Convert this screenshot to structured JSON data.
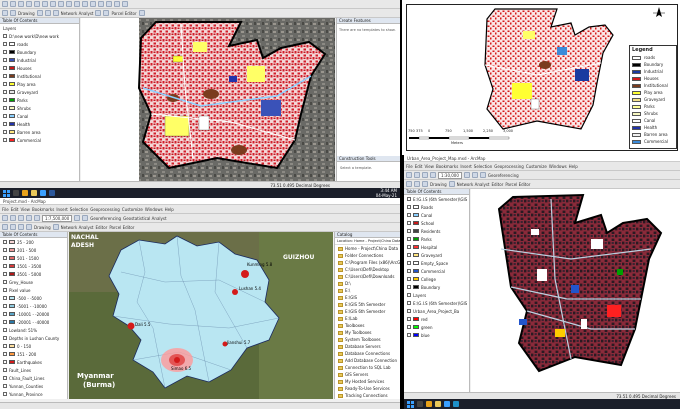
{
  "tl": {
    "toolbar": [
      "Drawing",
      "Network Analyst",
      "Parcel Editor"
    ],
    "toc_title": "Table Of Contents",
    "layers": [
      {
        "label": "Layers",
        "swatch": ""
      },
      {
        "label": "D:\\new work\\D\\new work",
        "swatch": ""
      },
      {
        "label": "roads",
        "swatch": "#ffffff"
      },
      {
        "label": "Boundary",
        "swatch": "#000000"
      },
      {
        "label": "Industrial",
        "swatch": "#3a52b8"
      },
      {
        "label": "Houses",
        "swatch": "#c81818"
      },
      {
        "label": "Institutional",
        "swatch": "#7a3c1e"
      },
      {
        "label": "Play area",
        "swatch": "#ffff33"
      },
      {
        "label": "Graveyard",
        "swatch": "#e6e6e6"
      },
      {
        "label": "Parks",
        "swatch": "#00a000"
      },
      {
        "label": "Shrubs",
        "swatch": "#f6f6c0"
      },
      {
        "label": "Canal",
        "swatch": "#8ad0ff"
      },
      {
        "label": "Health",
        "swatch": "#2233aa"
      },
      {
        "label": "Barren area",
        "swatch": "#ffe680"
      },
      {
        "label": "Commercial",
        "swatch": "#ff2020"
      }
    ],
    "create_features": "Create Features",
    "template_msg": "There are no templates to show.",
    "construction_tools": "Construction Tools",
    "select_template": "Select a template.",
    "status": "73.51  0.495  Decimal Degrees"
  },
  "tr": {
    "legend_title": "Legend",
    "legend": [
      {
        "label": "roads",
        "color": "#ffffff"
      },
      {
        "label": "Boundary",
        "color": "#000000"
      },
      {
        "label": "Industrial",
        "color": "#1a3aa0"
      },
      {
        "label": "Houses",
        "color": "#d41a1a"
      },
      {
        "label": "Institutional",
        "color": "#7a3c1e"
      },
      {
        "label": "Play area",
        "color": "#ffff33"
      },
      {
        "label": "Graveyard",
        "color": "#f2e08a"
      },
      {
        "label": "Parks",
        "color": "#ffff99"
      },
      {
        "label": "Shrubs",
        "color": "#f6f6c0"
      },
      {
        "label": "Canal",
        "color": "#ffffff"
      },
      {
        "label": "Health",
        "color": "#2233aa"
      },
      {
        "label": "Barren area",
        "color": "#f0f0f0"
      },
      {
        "label": "Commercial",
        "color": "#3b8bd9"
      }
    ],
    "scale_ticks": [
      "750",
      "375",
      "0",
      "750",
      "1,500",
      "2,250",
      "3,000"
    ],
    "scale_unit": "Meters"
  },
  "bl": {
    "title": "Project.mxd - ArcMap",
    "menus": [
      "File",
      "Edit",
      "View",
      "Bookmarks",
      "Insert",
      "Selection",
      "Geoprocessing",
      "Customize",
      "Windows",
      "Help"
    ],
    "scale": "1:7,500,000",
    "toolbar": [
      "Georeferencing",
      "Geostatistical Analyst",
      "Drawing",
      "Network Analyst",
      "Editor",
      "Parcel Editor"
    ],
    "toc_title": "Table Of Contents",
    "toc_rows": [
      "25 - 200",
      "201 - 500",
      "501 - 1500",
      "1501 - 3500",
      "3501 - 5000",
      "Grey_House",
      "Pixel value",
      "-500 - -5000",
      "-5001 - -10000",
      "-10001 - -20000",
      "-20001 - -40000",
      "Lowland: 51%",
      "Depths in Lushan County",
      "0 - 150",
      "151 - 200",
      "Earthquakes",
      "Fault_Lines",
      "China_Fault_Lines",
      "Yunnan_Counties",
      "Yunnan_Province"
    ],
    "map_labels": {
      "nachal": "NACHAL",
      "adesh": "ADESH",
      "guizhou": "GUIZHOU",
      "myanmar": "Myanmar",
      "burma": "(Burma)",
      "quake1": "Kunming 5.8",
      "quake2": "Lushan 5.4",
      "quake3": "Dali 5.5",
      "quake4": "Simao 6.5",
      "quake5": "Jianshui 5.7"
    },
    "catalog_title": "Catalog",
    "catalog_location": "Location: Home - Project\\China Data",
    "catalog": [
      "Home - Project\\China Data",
      "Folder Connections",
      "C:\\Program Files (x86)\\ArcGIS",
      "C:\\Users\\Defi\\Desktop",
      "C:\\Users\\Defi\\Downloads",
      "D:\\",
      "E:\\",
      "E:\\GIS",
      "E:\\GIS 5th Semester",
      "E:\\GIS 6th Semester",
      "E:\\Lab",
      "Toolboxes",
      "My Toolboxes",
      "System Toolboxes",
      "Database Servers",
      "Database Connections",
      "Add Database Connection",
      "Connection to SQL Lab",
      "GIS Servers",
      "My Hosted Services",
      "Ready-To-Use Services",
      "Tracking Connections"
    ],
    "clock_time": "3:44 AM",
    "clock_date": "04-May-21"
  },
  "br": {
    "title": "Urban_Area_Project_Map.mxd - ArcMap",
    "menus": [
      "File",
      "Edit",
      "View",
      "Bookmarks",
      "Insert",
      "Selection",
      "Geoprocessing",
      "Customize",
      "Windows",
      "Help"
    ],
    "scale": "1:30,000",
    "editor_label": "Georeferencing",
    "toolbar2": [
      "Drawing",
      "Network Analyst",
      "Editor",
      "Parcel Editor"
    ],
    "toc_title": "Table Of Contents",
    "toc_rows": [
      {
        "label": "E:\\G.I.S (6th Semester)\\GIS",
        "swatch": ""
      },
      {
        "label": "Roads",
        "swatch": "#ffffff"
      },
      {
        "label": "Canal",
        "swatch": "#8ad0ff"
      },
      {
        "label": "School",
        "swatch": "#c81818"
      },
      {
        "label": "Residents",
        "swatch": "#444444"
      },
      {
        "label": "Parks",
        "swatch": "#00a000"
      },
      {
        "label": "Hospital",
        "swatch": "#ff3030"
      },
      {
        "label": "Graveyard",
        "swatch": "#ffe680"
      },
      {
        "label": "Empty_Space",
        "swatch": "#ffffff"
      },
      {
        "label": "Commercial",
        "swatch": "#2255cc"
      },
      {
        "label": "College",
        "swatch": "#ffcc00"
      },
      {
        "label": "Boundary",
        "swatch": "#000000"
      },
      {
        "label": "Layers",
        "swatch": ""
      },
      {
        "label": "E:\\G.I.S (6th Semester)\\GIS",
        "swatch": ""
      },
      {
        "label": "Urban_Area_Project_Ba",
        "swatch": ""
      },
      {
        "label": "red",
        "swatch": "#ff0000"
      },
      {
        "label": "green",
        "swatch": "#00ff00"
      },
      {
        "label": "blue",
        "swatch": "#0000ff"
      }
    ],
    "status": "73.51  0.495  Decimal Degrees"
  }
}
